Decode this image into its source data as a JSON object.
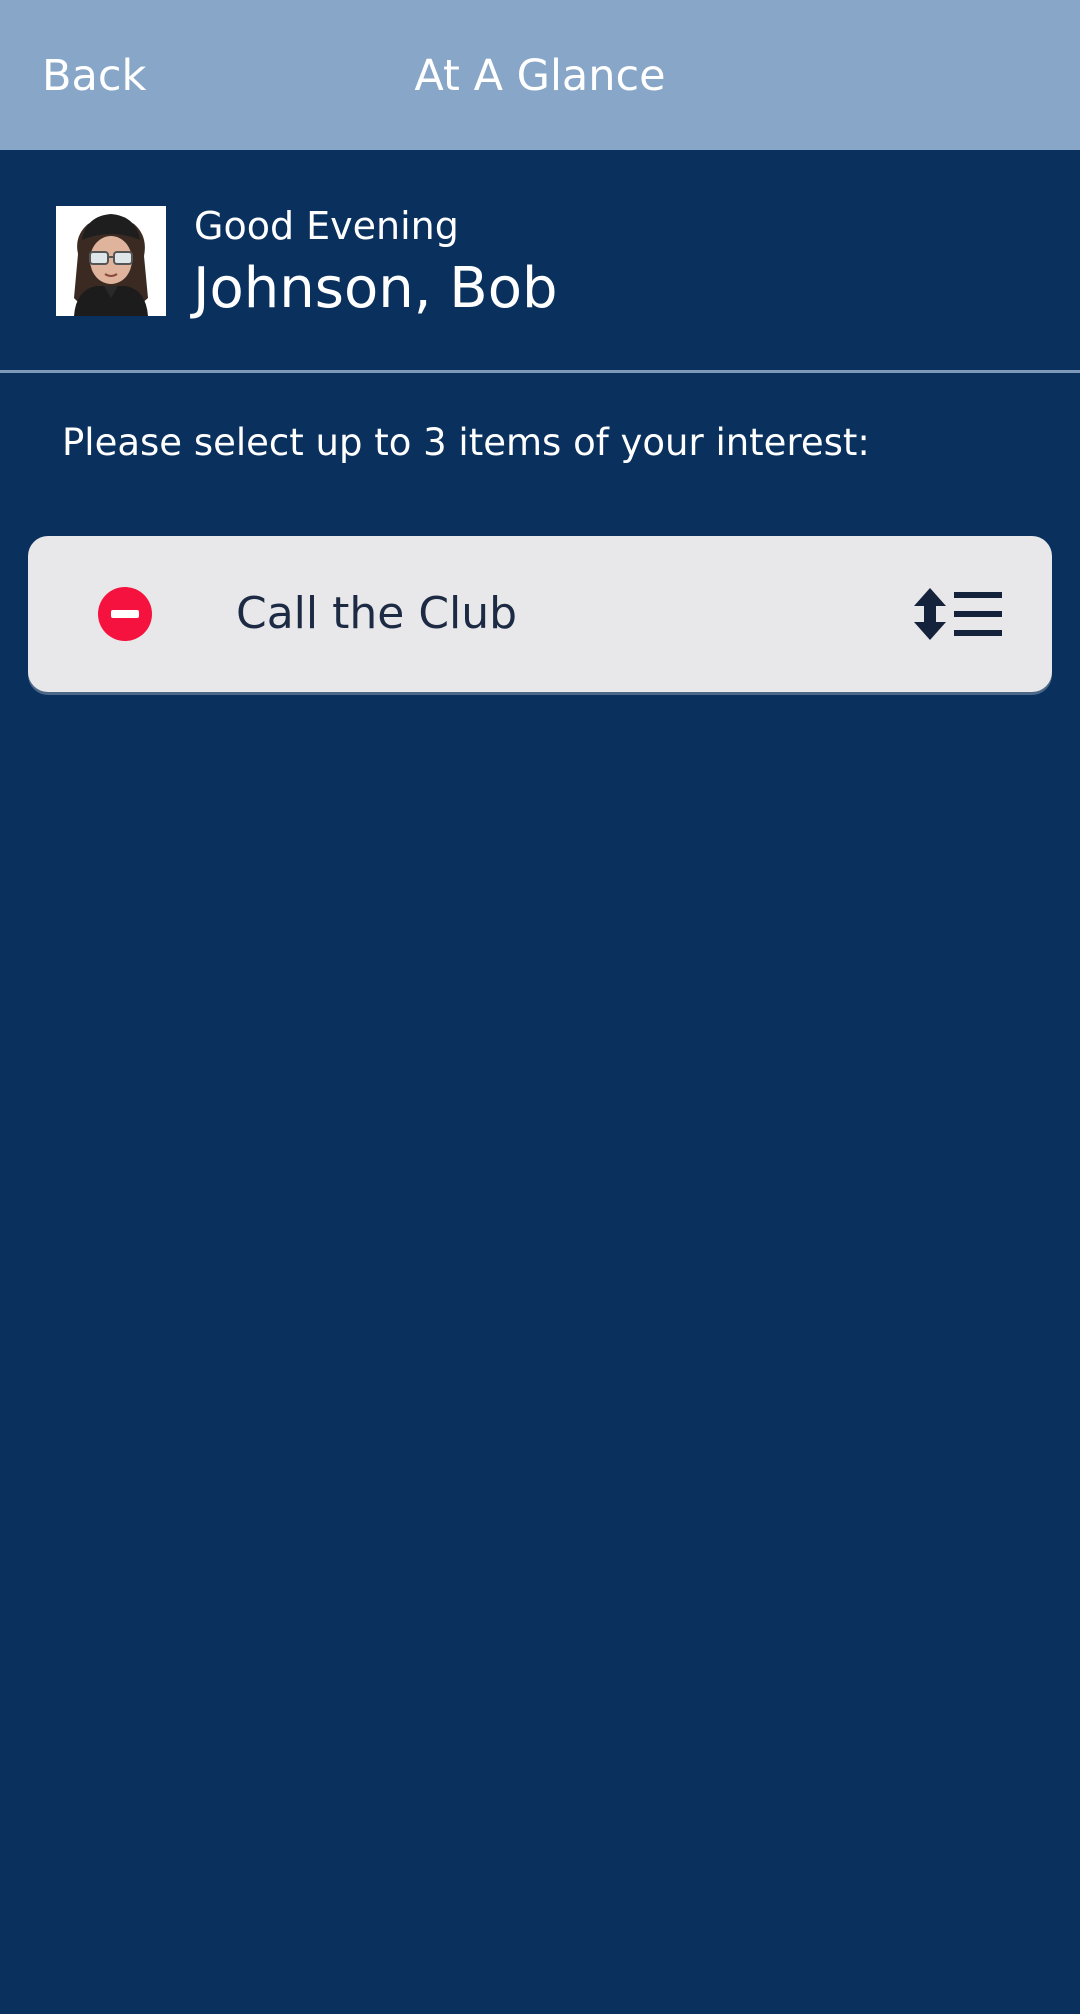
{
  "header": {
    "back_label": "Back",
    "title": "At A Glance",
    "background": "#88a6c8"
  },
  "profile": {
    "greeting": "Good Evening",
    "name": "Johnson, Bob",
    "avatar_icon": "avatar-cartoon-person"
  },
  "instruction": "Please select up to 3 items of your interest:",
  "items": [
    {
      "label": "Call the Club",
      "remove_icon": "minus-circle-icon",
      "reorder_icon": "drag-reorder-icon"
    }
  ],
  "colors": {
    "page_background": "#0a305d",
    "card_background": "#e8e8ea",
    "remove_red": "#f5123f",
    "item_text": "#1d2a44"
  }
}
